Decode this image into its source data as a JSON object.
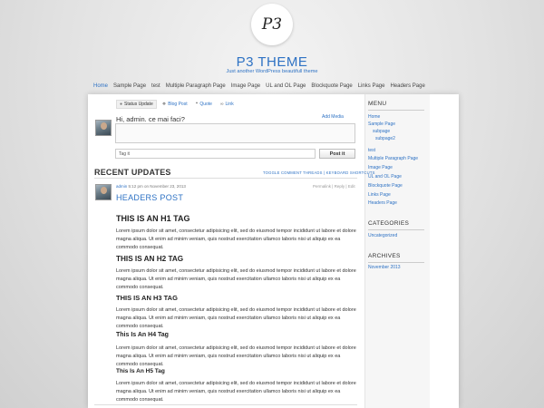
{
  "header": {
    "logo_text": "P3",
    "site_title": "P3 THEME",
    "site_description": "Just another WordPress beautifull theme"
  },
  "nav": {
    "items": [
      "Home",
      "Sample Page",
      "test",
      "Multiple Paragraph Page",
      "Image Page",
      "UL and OL Page",
      "Blockquote Page",
      "Links Page",
      "Headers Page"
    ]
  },
  "postbox": {
    "tabs": [
      {
        "label": "Status Update",
        "icon": "user-icon"
      },
      {
        "label": "Blog Post",
        "icon": "pin-icon"
      },
      {
        "label": "Quote",
        "icon": "quote-icon"
      },
      {
        "label": "Link",
        "icon": "link-icon"
      }
    ],
    "greeting": "Hi, admin. ce mai faci?",
    "add_media": "Add Media",
    "tag_value": "Tag it",
    "post_button": "Post it"
  },
  "recent": {
    "heading": "RECENT UPDATES",
    "links": "TOGGLE COMMENT THREADS | KEYBOARD SHORTCUTS"
  },
  "post": {
    "author": "admin",
    "meta": "5:12 pm on November 23, 2013",
    "actions": "Permalink | Reply | Edit",
    "title": "HEADERS POST",
    "h1": "THIS IS AN H1 TAG",
    "h2": "THIS IS AN H2 TAG",
    "h3": "THIS IS AN H3 TAG",
    "h4": "This Is An H4 Tag",
    "h5": "This Is An H5 Tag",
    "paragraph": "Lorem ipsum dolor sit amet, consectetur adipisicing elit, sed do eiusmod tempor incididunt ut labore et dolore magna aliqua. Ut enim ad minim veniam, quis nostrud exercitation ullamco laboris nisi ut aliquip ex ea commodo consequat."
  },
  "sidebar": {
    "menu_heading": "MENU",
    "menu_items": [
      "Home",
      "Sample Page",
      "subpage",
      "subpage2",
      "test",
      "Multiple Paragraph Page",
      "Image Page",
      "UL and OL Page",
      "Blockquote Page",
      "Links Page",
      "Headers Page"
    ],
    "categories_heading": "CATEGORIES",
    "categories": [
      "Uncategorized"
    ],
    "archives_heading": "ARCHIVES",
    "archives": [
      "November 2013"
    ]
  },
  "colors": {
    "accent": "#2e72c4",
    "background": "#e2e2e2"
  }
}
